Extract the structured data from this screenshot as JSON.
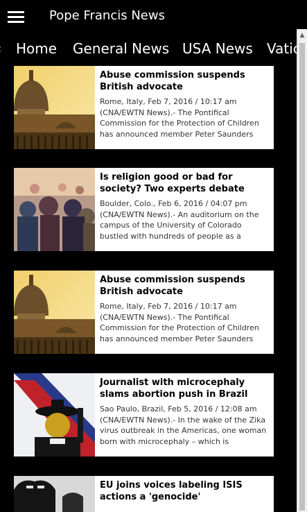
{
  "app": {
    "title": "Pope Francis News"
  },
  "tabs": [
    "Home",
    "General News",
    "USA News",
    "Vatic"
  ],
  "articles": [
    {
      "headline": "Abuse commission suspends British advocate",
      "meta": "Rome, Italy, Feb 7, 2016 / 10:17 am",
      "snippet": "(CNA/EWTN News).- The Pontifical Commission for the Protection of Children has announced member Peter Saunders",
      "image": "st-peters-basilica"
    },
    {
      "headline": "Is religion good or bad for society? Two experts debate",
      "meta": "Boulder, Colo., Feb 6, 2016 / 04:07 pm",
      "snippet": "(CNA/EWTN News).- An auditorium on the campus of the University of Colorado bustled with hundreds of people as a",
      "image": "crowd"
    },
    {
      "headline": "Abuse commission suspends British advocate",
      "meta": "Rome, Italy, Feb 7, 2016 / 10:17 am",
      "snippet": "(CNA/EWTN News).- The Pontifical Commission for the Protection of Children has announced member Peter Saunders",
      "image": "st-peters-basilica"
    },
    {
      "headline": "Journalist with microcephaly slams abortion push in Brazil",
      "meta": "Sao Paulo, Brazil, Feb 5, 2016 / 12:08 am",
      "snippet": "(CNA/EWTN News).- In the wake of the Zika virus outbreak in the Americas, one woman born with microcephaly – which is",
      "image": "graduate"
    },
    {
      "headline": "EU joins voices labeling ISIS actions a 'genocide'",
      "meta": "",
      "snippet": "",
      "image": "masked-figure"
    }
  ]
}
